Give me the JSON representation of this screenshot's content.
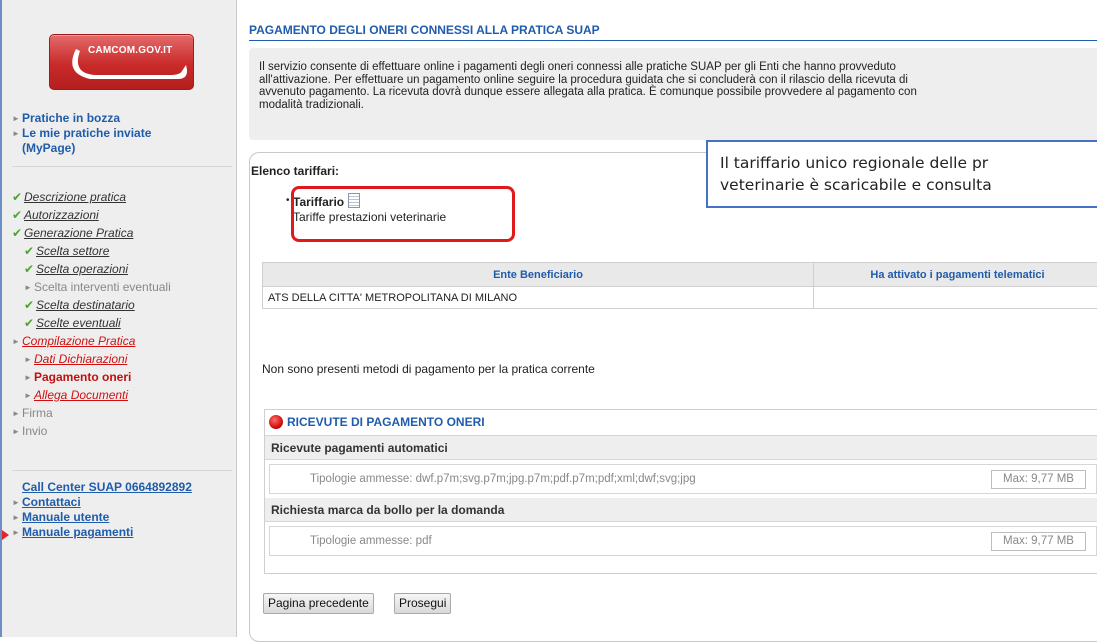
{
  "logo": {
    "text": "CAMCOM.GOV.IT"
  },
  "sidebar": {
    "top_links": [
      {
        "label": "Pratiche in bozza"
      },
      {
        "label": "Le mie pratiche inviate"
      },
      {
        "label": "(MyPage)"
      }
    ],
    "steps": {
      "descrizione": "Descrizione pratica",
      "autorizzazioni": "Autorizzazioni",
      "generazione": "Generazione Pratica",
      "scelta_settore": "Scelta settore",
      "scelta_operazioni": "Scelta operazioni",
      "scelta_interventi": "Scelta interventi eventuali",
      "scelta_destinatario": "Scelta destinatario",
      "scelte_eventuali": "Scelte eventuali",
      "compilazione": "Compilazione Pratica",
      "dati_dichiarazioni": "Dati Dichiarazioni",
      "pagamento_oneri": "Pagamento oneri",
      "allega_documenti": "Allega Documenti",
      "firma": "Firma",
      "invio": "Invio"
    },
    "help": {
      "call_center": "Call Center SUAP 0664892892",
      "contattaci": "Contattaci",
      "manuale_utente": "Manuale utente",
      "manuale_pagamenti": "Manuale pagamenti"
    }
  },
  "main": {
    "title": "PAGAMENTO DEGLI ONERI CONNESSI ALLA PRATICA SUAP",
    "intro_lines": [
      "Il servizio consente di effettuare online i pagamenti degli oneri connessi alle pratiche SUAP per gli Enti che hanno provveduto",
      "all'attivazione. Per effettuare un pagamento online seguire la procedura guidata che si concluderà con il rilascio della ricevuta di",
      "avvenuto pagamento. La ricevuta dovrà dunque essere allegata alla pratica. È comunque possibile provvedere al pagamento con",
      "modalità tradizionali."
    ],
    "elenco_label": "Elenco tariffari:",
    "tariffario": {
      "title": "Tariffario",
      "link": "Tariffe prestazioni veterinarie"
    },
    "callout_lines": [
      "Il tariffario unico regionale delle pr",
      "veterinarie è scaricabile e consulta"
    ],
    "table": {
      "headers": [
        "Ente Beneficiario",
        "Ha attivato i pagamenti telematici"
      ],
      "rows": [
        [
          "ATS DELLA CITTA' METROPOLITANA DI MILANO",
          ""
        ]
      ]
    },
    "no_methods": "Non sono presenti metodi di pagamento per la pratica corrente",
    "ricevute": {
      "title": "RICEVUTE DI PAGAMENTO ONERI",
      "sections": [
        {
          "heading": "Ricevute pagamenti automatici",
          "types": "Tipologie ammesse: dwf.p7m;svg.p7m;jpg.p7m;pdf.p7m;pdf;xml;dwf;svg;jpg",
          "max": "Max: 9,77 MB"
        },
        {
          "heading": "Richiesta marca da bollo per la domanda",
          "types": "Tipologie ammesse: pdf",
          "max": "Max: 9,77 MB"
        }
      ]
    },
    "buttons": {
      "prev": "Pagina precedente",
      "next": "Prosegui"
    }
  }
}
